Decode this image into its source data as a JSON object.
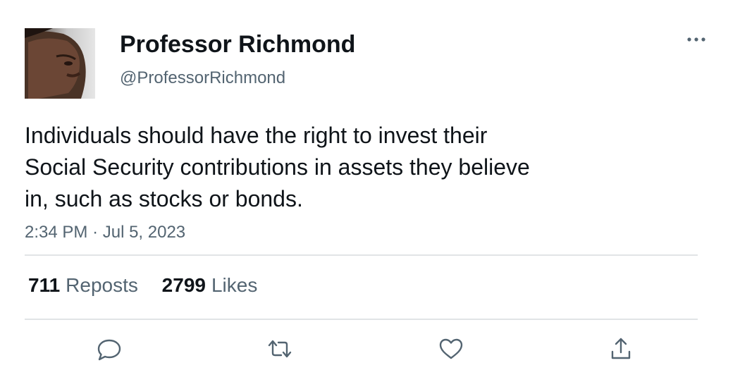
{
  "author": {
    "display_name": "Professor Richmond",
    "handle": "@ProfessorRichmond"
  },
  "tweet": {
    "text_lines": [
      "Individuals should have the right to invest their",
      "Social Security contributions in assets they believe",
      "in, such as stocks or bonds."
    ],
    "time": "2:34 PM",
    "separator": "·",
    "date": "Jul 5, 2023"
  },
  "stats": {
    "reposts_count": "711",
    "reposts_label": "Reposts",
    "likes_count": "2799",
    "likes_label": "Likes"
  },
  "icons": {
    "more": "more-horizontal-icon",
    "reply": "reply-icon",
    "repost": "repost-icon",
    "like": "heart-icon",
    "share": "share-icon"
  },
  "colors": {
    "text_primary": "#0f1419",
    "text_secondary": "#536471",
    "divider": "#e1e4e6",
    "background": "#ffffff"
  }
}
